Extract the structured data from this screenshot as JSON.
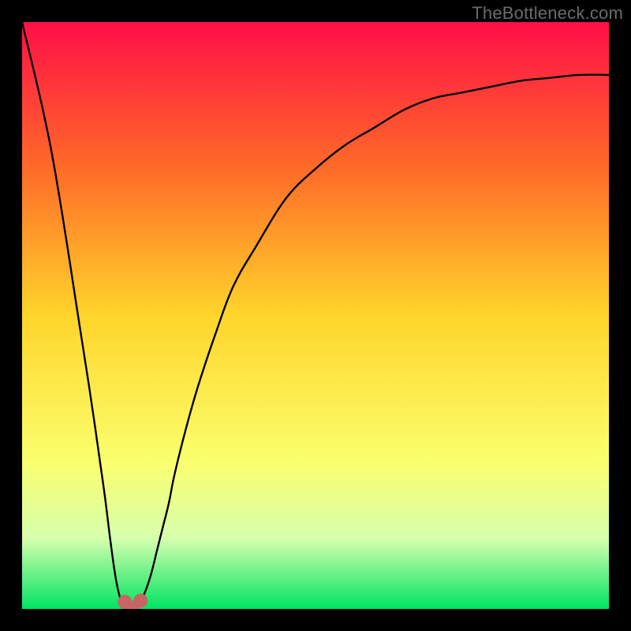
{
  "watermark": "TheBottleneck.com",
  "chart_data": {
    "type": "line",
    "title": "",
    "xlabel": "",
    "ylabel": "",
    "xlim": [
      0,
      100
    ],
    "ylim": [
      0,
      100
    ],
    "grid": false,
    "legend": false,
    "background_gradient": {
      "stops": [
        {
          "offset": 0.0,
          "color": "#ff0f47"
        },
        {
          "offset": 0.25,
          "color": "#ff6b28"
        },
        {
          "offset": 0.5,
          "color": "#ffd52a"
        },
        {
          "offset": 0.75,
          "color": "#faff6e"
        },
        {
          "offset": 0.88,
          "color": "#d6ffad"
        },
        {
          "offset": 1.0,
          "color": "#00e463"
        }
      ]
    },
    "series": [
      {
        "name": "curve",
        "x": [
          0,
          5,
          10,
          12,
          14,
          15,
          16,
          17,
          18,
          19,
          20,
          21,
          22,
          23,
          24,
          25,
          26,
          28,
          30,
          33,
          36,
          40,
          45,
          50,
          55,
          60,
          65,
          70,
          75,
          80,
          85,
          90,
          95,
          100
        ],
        "y": [
          100,
          78,
          47,
          34,
          20,
          12,
          5,
          1,
          0,
          0,
          1,
          3,
          6,
          10,
          14,
          18,
          23,
          31,
          38,
          47,
          55,
          62,
          70,
          75,
          79,
          82,
          85,
          87,
          88,
          89,
          90,
          90.5,
          91,
          91
        ]
      }
    ],
    "markers": [
      {
        "name": "cusp-left",
        "x": 17.5,
        "y": 1.2
      },
      {
        "name": "cusp-bottom",
        "x": 18.7,
        "y": 0.2
      },
      {
        "name": "cusp-right",
        "x": 20.2,
        "y": 1.4
      }
    ],
    "marker_style": {
      "color": "#c86464",
      "radius_px": 9
    }
  }
}
